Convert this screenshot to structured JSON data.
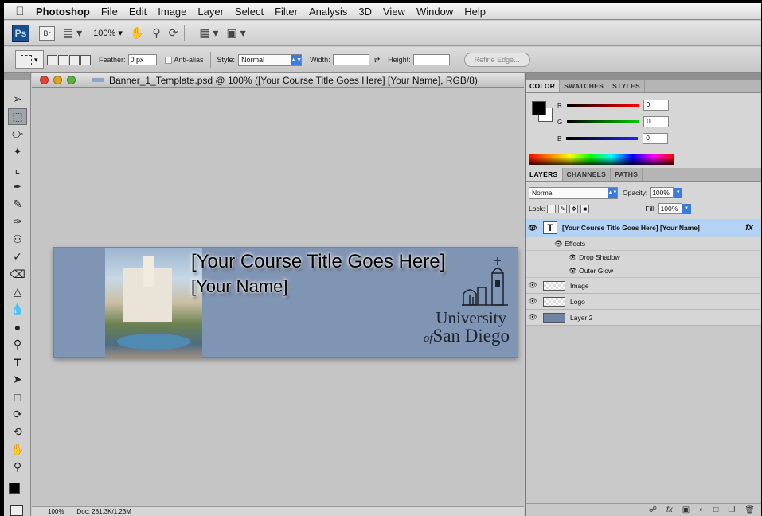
{
  "menubar": {
    "app_name": "Photoshop",
    "items": [
      "File",
      "Edit",
      "Image",
      "Layer",
      "Select",
      "Filter",
      "Analysis",
      "3D",
      "View",
      "Window",
      "Help"
    ]
  },
  "appbar": {
    "ps_label": "Ps",
    "br_label": "Br",
    "zoom": "100% ▾"
  },
  "options": {
    "feather_label": "Feather:",
    "feather_value": "0 px",
    "antialias_label": "Anti-alias",
    "style_label": "Style:",
    "style_value": "Normal",
    "width_label": "Width:",
    "height_label": "Height:",
    "refine_label": "Refine Edge..."
  },
  "document": {
    "title": "Banner_1_Template.psd @ 100% ([Your Course Title Goes Here] [Your Name], RGB/8)",
    "banner_title": "[Your Course Title Goes Here]",
    "banner_name": "[Your Name]",
    "logo_line1": "University",
    "logo_of": "of",
    "logo_line2": "San Diego",
    "status_zoom": "100%",
    "status_doc": "Doc: 281.3K/1.23M"
  },
  "color_panel": {
    "tabs": [
      "COLOR",
      "SWATCHES",
      "STYLES"
    ],
    "channels": [
      {
        "label": "R",
        "value": "0",
        "color": "#d41f1f"
      },
      {
        "label": "G",
        "value": "0",
        "color": "#1fa31f"
      },
      {
        "label": "B",
        "value": "0",
        "color": "#1f3fd4"
      }
    ]
  },
  "layers_panel": {
    "tabs": [
      "LAYERS",
      "CHANNELS",
      "PATHS"
    ],
    "blend_mode": "Normal",
    "opacity_label": "Opacity:",
    "opacity_value": "100%",
    "lock_label": "Lock:",
    "fill_label": "Fill:",
    "fill_value": "100%",
    "selected_layer": "[Your Course Title Goes Here] [Your Name]",
    "fx_label": "fx",
    "effects_label": "Effects",
    "effects": [
      "Drop Shadow",
      "Outer Glow"
    ],
    "layers": [
      "Image",
      "Logo",
      "Layer 2"
    ]
  }
}
